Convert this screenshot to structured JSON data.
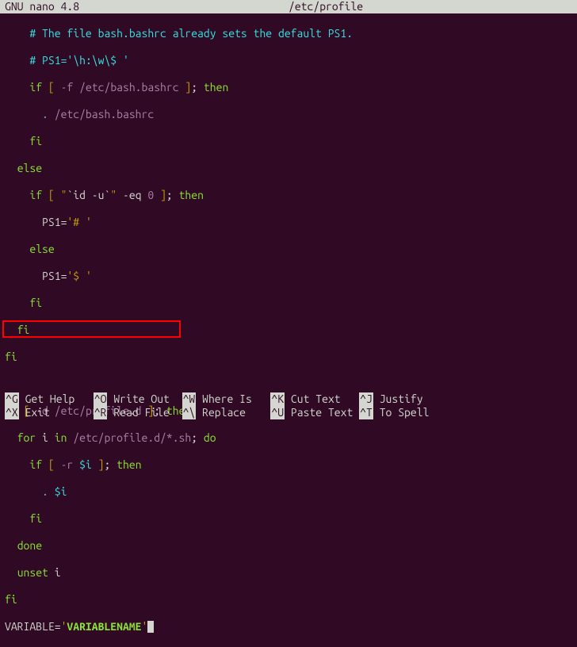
{
  "titlebar": {
    "app": "GNU nano 4.8",
    "filename": "/etc/profile"
  },
  "code": {
    "l1_comment": "# The file bash.bashrc already sets the default PS1.",
    "l2_comment_a": "# PS1='",
    "l2_comment_b": "\\h:\\w\\$ ",
    "l2_comment_c": "'",
    "l3_if": "if",
    "l3_lb": " [ ",
    "l3_flag": "-f",
    "l3_path": " /etc/bash.bashrc ",
    "l3_rb": "]",
    "l3_semi": ";",
    "l3_then": " then",
    "l4_dot": ". ",
    "l4_path": "/etc/bash.bashrc",
    "l5_fi": "fi",
    "l6_else": "else",
    "l7_if": "if",
    "l7_lb": " [ ",
    "l7_q1": "\"",
    "l7_cmd": "`id -u`",
    "l7_q2": "\"",
    "l7_eq": " -eq ",
    "l7_zero": "0 ",
    "l7_rb": "]",
    "l7_semi": ";",
    "l7_then": " then",
    "l8_ps1": "PS1=",
    "l8_val": "'# '",
    "l9_else": "else",
    "l10_ps1": "PS1=",
    "l10_val": "'$ '",
    "l11_fi": "fi",
    "l12_fi": "fi",
    "l13_fi": "fi",
    "l15_if": "if",
    "l15_lb": " [ ",
    "l15_flag": "-d",
    "l15_path": " /etc/profile.d ",
    "l15_rb": "]",
    "l15_semi": ";",
    "l15_then": " then",
    "l16_for": "for",
    "l16_i": " i ",
    "l16_in": "in",
    "l16_path": " /etc/profile.d/*.sh",
    "l16_semi": ";",
    "l16_do": " do",
    "l17_if": "if",
    "l17_lb": " [ ",
    "l17_flag": "-r",
    "l17_var": " $i ",
    "l17_rb": "]",
    "l17_semi": ";",
    "l17_then": " then",
    "l18_dot": ". ",
    "l18_var": "$i",
    "l19_fi": "fi",
    "l20_done": "done",
    "l21_unset": "unset",
    "l21_i": " i",
    "l22_fi": "fi",
    "l23_var": "VARIABLE=",
    "l23_q1": "'",
    "l23_val": "VARIABLENAME",
    "l23_q2": "'"
  },
  "shortcuts": {
    "row1": [
      {
        "key": "^G",
        "label": "Get Help"
      },
      {
        "key": "^O",
        "label": "Write Out"
      },
      {
        "key": "^W",
        "label": "Where Is"
      },
      {
        "key": "^K",
        "label": "Cut Text"
      },
      {
        "key": "^J",
        "label": "Justify"
      }
    ],
    "row2": [
      {
        "key": "^X",
        "label": "Exit"
      },
      {
        "key": "^R",
        "label": "Read File"
      },
      {
        "key": "^\\",
        "label": "Replace"
      },
      {
        "key": "^U",
        "label": "Paste Text"
      },
      {
        "key": "^T",
        "label": "To Spell"
      }
    ]
  }
}
